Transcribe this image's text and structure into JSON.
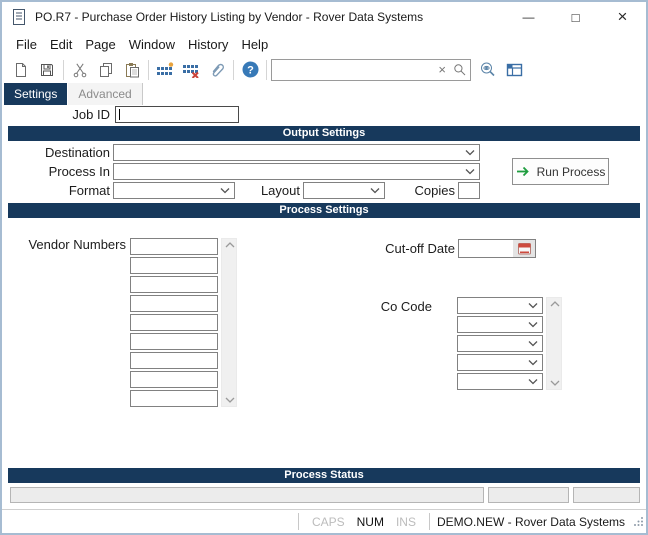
{
  "colors": {
    "accent_navy": "#17395c",
    "window_frame": "#a6bcd2",
    "toolbar_icon_blue": "#3a6ea5",
    "help_blue": "#3779b7",
    "run_arrow_green": "#1f9d3f",
    "delete_red": "#c94339",
    "add_orange": "#e8a33d"
  },
  "window": {
    "title": "PO.R7 - Purchase Order History Listing by Vendor - Rover Data Systems",
    "controls": {
      "minimize": "—",
      "maximize": "□",
      "close": "×"
    }
  },
  "menu": [
    "File",
    "Edit",
    "Page",
    "Window",
    "History",
    "Help"
  ],
  "toolbar": {
    "icons": [
      "new-document",
      "save",
      "cut",
      "copy",
      "paste",
      "add-record",
      "delete-record",
      "attachment",
      "help",
      "lookup",
      "layout"
    ],
    "help_glyph": "?",
    "search": {
      "value": "",
      "placeholder": "",
      "clear_glyph": "×"
    }
  },
  "tabs": {
    "settings": "Settings",
    "advanced": "Advanced"
  },
  "sections": {
    "output": "Output Settings",
    "process": "Process Settings",
    "status": "Process Status"
  },
  "form": {
    "job_id_label": "Job ID",
    "job_id_value": "",
    "destination_label": "Destination",
    "destination_value": "",
    "process_in_label": "Process In",
    "process_in_value": "",
    "format_label": "Format",
    "format_value": "",
    "layout_label": "Layout",
    "layout_value": "",
    "copies_label": "Copies",
    "copies_value": "",
    "run_button_label": "Run Process"
  },
  "process": {
    "vendor_label": "Vendor Numbers",
    "vendor_slots": 9,
    "cutoff_label": "Cut-off Date",
    "cutoff_value": "",
    "co_code_label": "Co Code",
    "co_code_slots": 5
  },
  "statusbar": {
    "caps": "CAPS",
    "num": "NUM",
    "ins": "INS",
    "caps_active": false,
    "num_active": true,
    "ins_active": false,
    "session": "DEMO.NEW - Rover Data Systems"
  }
}
